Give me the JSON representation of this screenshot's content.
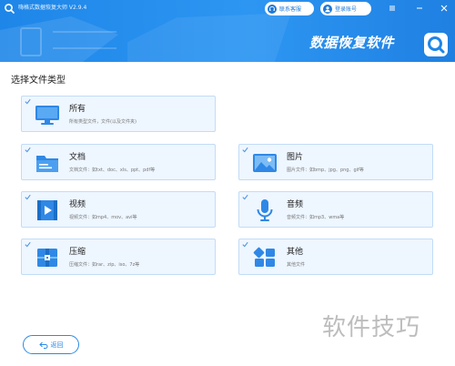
{
  "header": {
    "app_title": "嗨格式数据恢复大师 V2.9.4",
    "service_label": "联系客服",
    "login_label": "登录账号",
    "brand_text": "数据恢复软件",
    "colors": {
      "header_blue": "#1e86e8",
      "accent": "#2b8ae6"
    }
  },
  "page": {
    "section_title": "选择文件类型"
  },
  "file_types": {
    "all": {
      "name": "所有",
      "desc": "所有类型文件，文件(以及文件夹)",
      "icon": "monitor-icon"
    },
    "document": {
      "name": "文档",
      "desc": "文档文件：如txt、doc、xls、ppt、pdf等",
      "icon": "folder-icon"
    },
    "image": {
      "name": "图片",
      "desc": "图片文件：如bmp、jpg、png、gif等",
      "icon": "picture-icon"
    },
    "video": {
      "name": "视频",
      "desc": "视频文件：如mp4、mov、avi等",
      "icon": "video-icon"
    },
    "audio": {
      "name": "音频",
      "desc": "音频文件：如mp3、wma等",
      "icon": "microphone-icon"
    },
    "archive": {
      "name": "压缩",
      "desc": "压缩文件：如rar、zip、iso、7z等",
      "icon": "archive-icon"
    },
    "other": {
      "name": "其他",
      "desc": "其他文件",
      "icon": "grid-icon"
    }
  },
  "footer": {
    "back_label": "返回"
  },
  "watermark": "软件技巧"
}
